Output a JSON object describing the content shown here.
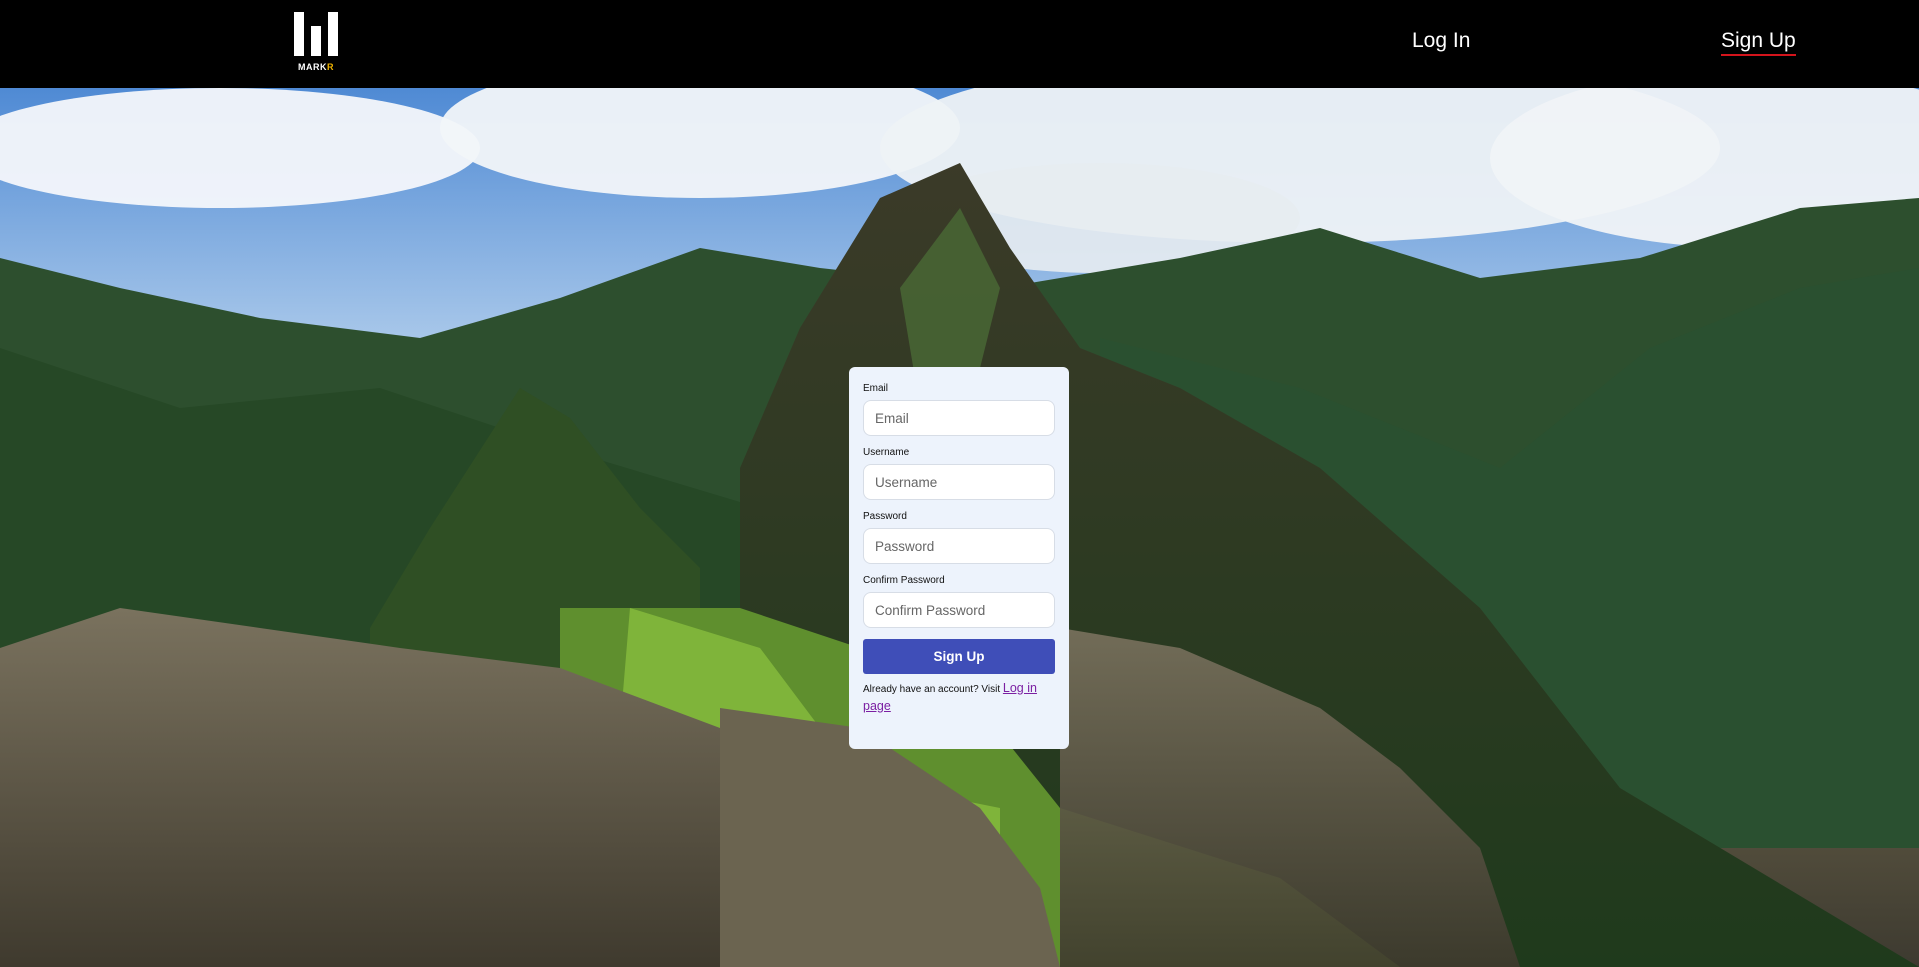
{
  "brand": {
    "logo_text_main": "MARK",
    "logo_text_accent": "R",
    "logo_icon": "bar-chart-logo-icon"
  },
  "nav": {
    "login_label": "Log In",
    "signup_label": "Sign Up"
  },
  "form": {
    "email_label": "Email",
    "email_placeholder": "Email",
    "email_value": "",
    "username_label": "Username",
    "username_placeholder": "Username",
    "username_value": "",
    "password_label": "Password",
    "password_placeholder": "Password",
    "password_value": "",
    "confirm_label": "Confirm Password",
    "confirm_placeholder": "Confirm Password",
    "confirm_value": "",
    "submit_label": "Sign Up",
    "footnote_text": "Already have an account? Visit ",
    "login_link_text": "Log in page"
  },
  "colors": {
    "navbar_bg": "#000000",
    "accent_underline": "#d4141c",
    "logo_accent": "#f0b400",
    "button_bg": "#3f4eb8",
    "card_bg": "#edf3fc",
    "link_color": "#7b1fa2"
  }
}
